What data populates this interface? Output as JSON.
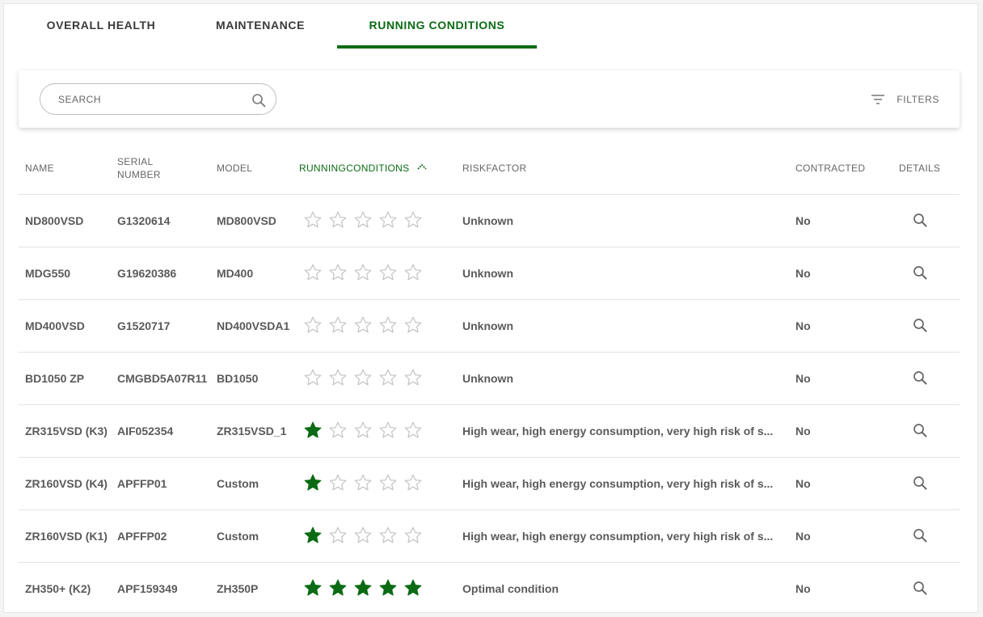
{
  "tabs": [
    {
      "label": "OVERALL HEALTH",
      "active": false
    },
    {
      "label": "MAINTENANCE",
      "active": false
    },
    {
      "label": "RUNNING CONDITIONS",
      "active": true
    }
  ],
  "colors": {
    "accent": "#0b6b14",
    "star_off": "#c4c4c4",
    "text": "#5a5a5a"
  },
  "toolbar": {
    "search_placeholder": "SEARCH",
    "search_icon": "magnifier-icon",
    "filters_label": "FILTERS",
    "filters_icon": "filter-lines-icon"
  },
  "table": {
    "headers": {
      "name": "NAME",
      "serial_line1": "SERIAL",
      "serial_line2": "NUMBER",
      "model": "MODEL",
      "running_conditions": "RUNNINGCONDITIONS",
      "risk_factor": "RISKFACTOR",
      "contracted": "CONTRACTED",
      "details": "DETAILS"
    },
    "sorted_column": "running_conditions",
    "sort_direction": "ascending",
    "max_stars": 5,
    "rows": [
      {
        "name": "ND800VSD",
        "serial": "G1320614",
        "model": "MD800VSD",
        "stars": 0,
        "risk": "Unknown",
        "contracted": "No"
      },
      {
        "name": "MDG550",
        "serial": "G19620386",
        "model": "MD400",
        "stars": 0,
        "risk": "Unknown",
        "contracted": "No"
      },
      {
        "name": "MD400VSD",
        "serial": "G1520717",
        "model": "ND400VSDA1",
        "stars": 0,
        "risk": "Unknown",
        "contracted": "No"
      },
      {
        "name": "BD1050 ZP",
        "serial": "CMGBD5A07R11",
        "model": "BD1050",
        "stars": 0,
        "risk": "Unknown",
        "contracted": "No"
      },
      {
        "name": "ZR315VSD (K3)",
        "serial": "AIF052354",
        "model": "ZR315VSD_1",
        "stars": 1,
        "risk": "High wear, high energy consumption, very high risk of s...",
        "contracted": "No"
      },
      {
        "name": "ZR160VSD (K4)",
        "serial": "APFFP01",
        "model": "Custom",
        "stars": 1,
        "risk": "High wear, high energy consumption, very high risk of s...",
        "contracted": "No"
      },
      {
        "name": "ZR160VSD (K1)",
        "serial": "APFFP02",
        "model": "Custom",
        "stars": 1,
        "risk": "High wear, high energy consumption, very high risk of s...",
        "contracted": "No"
      },
      {
        "name": "ZH350+ (K2)",
        "serial": "APF159349",
        "model": "ZH350P",
        "stars": 5,
        "risk": "Optimal condition",
        "contracted": "No"
      }
    ]
  }
}
